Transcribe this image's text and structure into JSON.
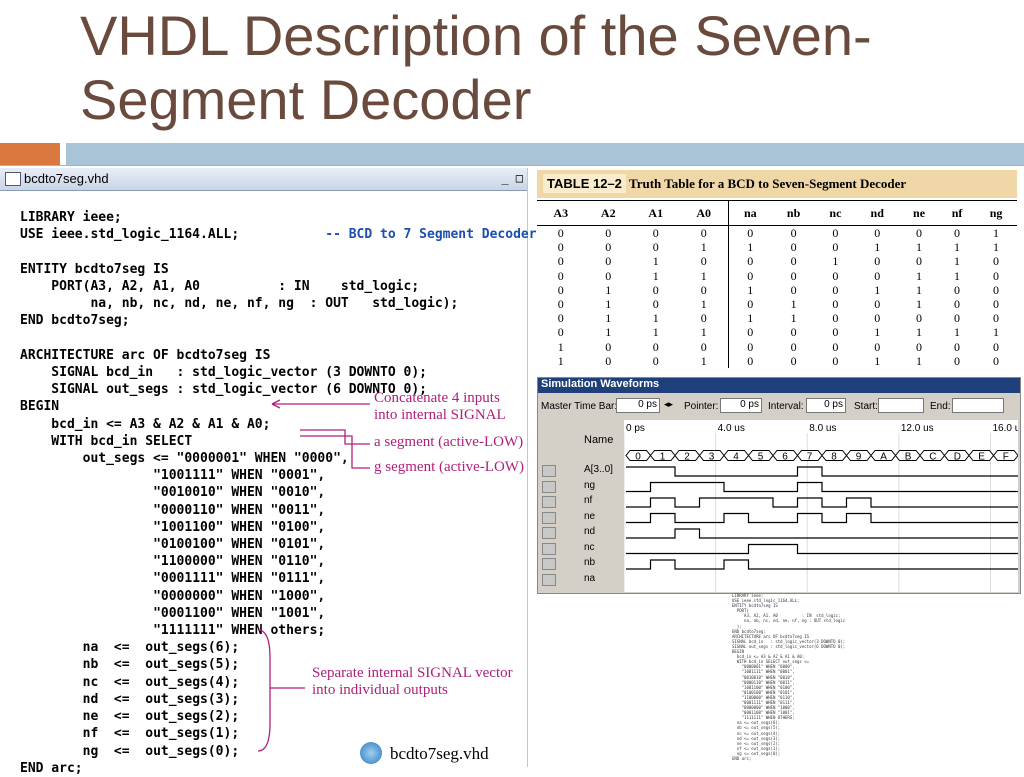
{
  "slide": {
    "title": "VHDL Description of the Seven-Segment Decoder",
    "title_line1": "VHDL Description of the Seven-",
    "title_line2": "Segment Decoder"
  },
  "window": {
    "title": "bcdto7seg.vhd",
    "buttons": "_ □"
  },
  "code": {
    "l1": "LIBRARY ieee;",
    "l2": "USE ieee.std_logic_1164.ALL;",
    "l2c": "-- BCD to 7 Segment Decoder --",
    "l3": "ENTITY bcdto7seg IS",
    "l4": "    PORT(A3, A2, A1, A0          : IN    std_logic;",
    "l5": "         na, nb, nc, nd, ne, nf, ng  : OUT   std_logic);",
    "l6": "END bcdto7seg;",
    "l7": "ARCHITECTURE arc OF bcdto7seg IS",
    "l8": "    SIGNAL bcd_in   : std_logic_vector (3 DOWNTO 0);",
    "l9": "    SIGNAL out_segs : std_logic_vector (6 DOWNTO 0);",
    "l10": "BEGIN",
    "l11": "    bcd_in <= A3 & A2 & A1 & A0;",
    "l12": "    WITH bcd_in SELECT",
    "l13": "        out_segs <= \"0000001\" WHEN \"0000\",",
    "rows": [
      "\"1001111\" WHEN \"0001\",",
      "\"0010010\" WHEN \"0010\",",
      "\"0000110\" WHEN \"0011\",",
      "\"1001100\" WHEN \"0100\",",
      "\"0100100\" WHEN \"0101\",",
      "\"1100000\" WHEN \"0110\",",
      "\"0001111\" WHEN \"0111\",",
      "\"0000000\" WHEN \"1000\",",
      "\"0001100\" WHEN \"1001\",",
      "\"1111111\" WHEN others;"
    ],
    "outs": [
      "na  <=  out_segs(6);",
      "nb  <=  out_segs(5);",
      "nc  <=  out_segs(4);",
      "nd  <=  out_segs(3);",
      "ne  <=  out_segs(2);",
      "nf  <=  out_segs(1);",
      "ng  <=  out_segs(0);"
    ],
    "end": "END arc;"
  },
  "callouts": {
    "c1a": "Concatenate 4 inputs",
    "c1b": "into internal SIGNAL",
    "c2": "a segment (active-LOW)",
    "c3": "g segment (active-LOW)",
    "c4a": "Separate internal SIGNAL vector",
    "c4b": "into individual outputs",
    "file": "bcdto7seg.vhd"
  },
  "truth_table": {
    "label": "TABLE 12–2",
    "title": "Truth Table for a BCD to Seven-Segment Decoder",
    "headers": [
      "A3",
      "A2",
      "A1",
      "A0",
      "na",
      "nb",
      "nc",
      "nd",
      "ne",
      "nf",
      "ng"
    ],
    "rows": [
      [
        "0",
        "0",
        "0",
        "0",
        "0",
        "0",
        "0",
        "0",
        "0",
        "0",
        "1"
      ],
      [
        "0",
        "0",
        "0",
        "1",
        "1",
        "0",
        "0",
        "1",
        "1",
        "1",
        "1"
      ],
      [
        "0",
        "0",
        "1",
        "0",
        "0",
        "0",
        "1",
        "0",
        "0",
        "1",
        "0"
      ],
      [
        "0",
        "0",
        "1",
        "1",
        "0",
        "0",
        "0",
        "0",
        "1",
        "1",
        "0"
      ],
      [
        "0",
        "1",
        "0",
        "0",
        "1",
        "0",
        "0",
        "1",
        "1",
        "0",
        "0"
      ],
      [
        "0",
        "1",
        "0",
        "1",
        "0",
        "1",
        "0",
        "0",
        "1",
        "0",
        "0"
      ],
      [
        "0",
        "1",
        "1",
        "0",
        "1",
        "1",
        "0",
        "0",
        "0",
        "0",
        "0"
      ],
      [
        "0",
        "1",
        "1",
        "1",
        "0",
        "0",
        "0",
        "1",
        "1",
        "1",
        "1"
      ],
      [
        "1",
        "0",
        "0",
        "0",
        "0",
        "0",
        "0",
        "0",
        "0",
        "0",
        "0"
      ],
      [
        "1",
        "0",
        "0",
        "1",
        "0",
        "0",
        "0",
        "1",
        "1",
        "0",
        "0"
      ]
    ]
  },
  "simulation": {
    "title": "Simulation Waveforms",
    "master_label": "Master Time Bar:",
    "master_val": "0 ps",
    "pointer_label": "Pointer:",
    "pointer_val": "0 ps",
    "interval_label": "Interval:",
    "interval_val": "0 ps",
    "start_label": "Start:",
    "end_label": "End:",
    "name_header": "Name",
    "time_labels": [
      "0 ps",
      "4.0 us",
      "8.0 us",
      "12.0 us",
      "16.0 us"
    ],
    "bus_name": "A[3..0]",
    "bus_values": [
      "0",
      "1",
      "2",
      "3",
      "4",
      "5",
      "6",
      "7",
      "8",
      "9",
      "A",
      "B",
      "C",
      "D",
      "E",
      "F"
    ],
    "signals": [
      "ng",
      "nf",
      "ne",
      "nd",
      "nc",
      "nb",
      "na"
    ],
    "waves": {
      "ng": [
        1,
        1,
        0,
        0,
        0,
        0,
        0,
        1,
        0,
        0,
        0,
        0,
        0,
        0,
        0,
        0
      ],
      "nf": [
        0,
        1,
        1,
        1,
        0,
        0,
        0,
        1,
        0,
        0,
        0,
        0,
        0,
        0,
        0,
        0
      ],
      "ne": [
        0,
        1,
        0,
        1,
        1,
        1,
        0,
        1,
        0,
        1,
        0,
        0,
        0,
        0,
        0,
        0
      ],
      "nd": [
        0,
        1,
        0,
        0,
        1,
        0,
        0,
        1,
        0,
        1,
        0,
        0,
        0,
        0,
        0,
        0
      ],
      "nc": [
        0,
        0,
        1,
        0,
        0,
        0,
        0,
        0,
        0,
        0,
        0,
        0,
        0,
        0,
        0,
        0
      ],
      "nb": [
        0,
        0,
        0,
        0,
        0,
        1,
        1,
        0,
        0,
        0,
        0,
        0,
        0,
        0,
        0,
        0
      ],
      "na": [
        0,
        1,
        0,
        0,
        1,
        0,
        0,
        0,
        0,
        0,
        0,
        0,
        0,
        0,
        0,
        0
      ]
    }
  },
  "mini_listing": "LIBRARY ieee;\nUSE ieee.std_logic_1164.ALL;\nENTITY bcdto7seg IS\n  PORT(\n     A3, A2, A1, A0          : IN  std_logic;\n     na, nb, nc, nd, ne, nf, ng : OUT std_logic\n  );\nEND bcdto7seg;\nARCHITECTURE arc OF bcdto7seg IS\nSIGNAL bcd_in   : std_logic_vector(3 DOWNTO 0);\nSIGNAL out_segs : std_logic_vector(6 DOWNTO 0);\nBEGIN\n  bcd_in <= A3 & A2 & A1 & A0;\n  WITH bcd_in SELECT out_segs <=\n    \"0000001\" WHEN \"0000\",\n    \"1001111\" WHEN \"0001\",\n    \"0010010\" WHEN \"0010\",\n    \"0000110\" WHEN \"0011\",\n    \"1001100\" WHEN \"0100\",\n    \"0100100\" WHEN \"0101\",\n    \"1100000\" WHEN \"0110\",\n    \"0001111\" WHEN \"0111\",\n    \"0000000\" WHEN \"1000\",\n    \"0001100\" WHEN \"1001\",\n    \"1111111\" WHEN OTHERS;\n  na <= out_segs(6);\n  nb <= out_segs(5);\n  nc <= out_segs(4);\n  nd <= out_segs(3);\n  ne <= out_segs(2);\n  nf <= out_segs(1);\n  ng <= out_segs(0);\nEND arc;"
}
